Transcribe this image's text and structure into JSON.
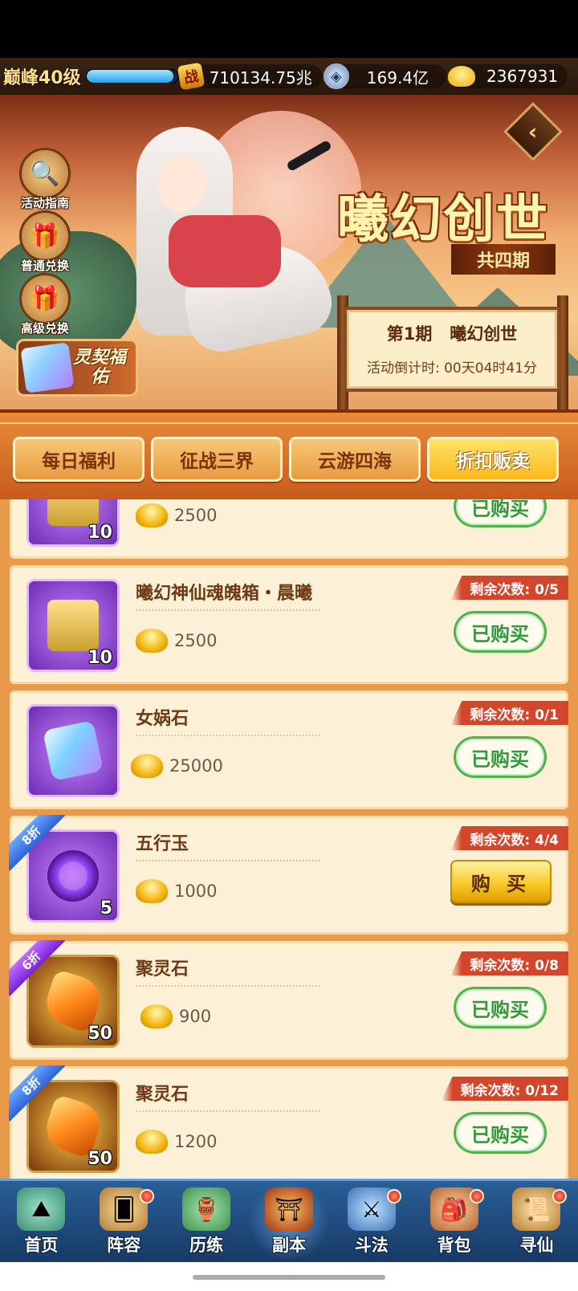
{
  "resources": {
    "level": "巅峰40级",
    "xp_fraction": 0.95,
    "power_icon_text": "战",
    "power": "710134.75兆",
    "coin": "169.4亿",
    "gold": "2367931"
  },
  "banner": {
    "side_buttons": [
      {
        "label": "活动指南",
        "icon": "magnifier-icon"
      },
      {
        "label": "普通兑换",
        "icon": "gift-box-icon"
      },
      {
        "label": "高级兑换",
        "icon": "gift-box-icon"
      }
    ],
    "promo_label": "灵契福佑",
    "back_glyph": "‹",
    "title": "曦幻创世",
    "subtitle": "共四期",
    "period_title": "第1期   曦幻创世",
    "countdown": "活动倒计时: 00天04时41分"
  },
  "tabs": [
    {
      "label": "每日福利",
      "active": false
    },
    {
      "label": "征战三界",
      "active": false
    },
    {
      "label": "云游四海",
      "active": false
    },
    {
      "label": "折扣贩卖",
      "active": true
    }
  ],
  "items": [
    {
      "name": "",
      "count": "10",
      "price": "2500",
      "remaining": "",
      "button": "已购买",
      "discount": "",
      "icon": "chest"
    },
    {
      "name": "曦幻神仙魂魄箱・晨曦",
      "count": "10",
      "price": "2500",
      "remaining": "剩余次数: 0/5",
      "button": "已购买",
      "discount": "",
      "icon": "chest"
    },
    {
      "name": "女娲石",
      "count": "",
      "price": "25000",
      "remaining": "剩余次数: 0/1",
      "button": "已购买",
      "discount": "",
      "icon": "gem"
    },
    {
      "name": "五行玉",
      "count": "5",
      "price": "1000",
      "remaining": "剩余次数: 4/4",
      "button": "购 买",
      "discount": "8折",
      "icon": "ring"
    },
    {
      "name": "聚灵石",
      "count": "50",
      "price": "900",
      "remaining": "剩余次数: 0/8",
      "button": "已购买",
      "discount": "6折",
      "icon": "crystal"
    },
    {
      "name": "聚灵石",
      "count": "50",
      "price": "1200",
      "remaining": "剩余次数: 0/12",
      "button": "已购买",
      "discount": "8折",
      "icon": "crystal"
    }
  ],
  "nav": [
    {
      "label": "首页",
      "badge": false
    },
    {
      "label": "阵容",
      "badge": true
    },
    {
      "label": "历练",
      "badge": false
    },
    {
      "label": "副本",
      "badge": false
    },
    {
      "label": "斗法",
      "badge": true
    },
    {
      "label": "背包",
      "badge": true
    },
    {
      "label": "寻仙",
      "badge": true
    }
  ]
}
